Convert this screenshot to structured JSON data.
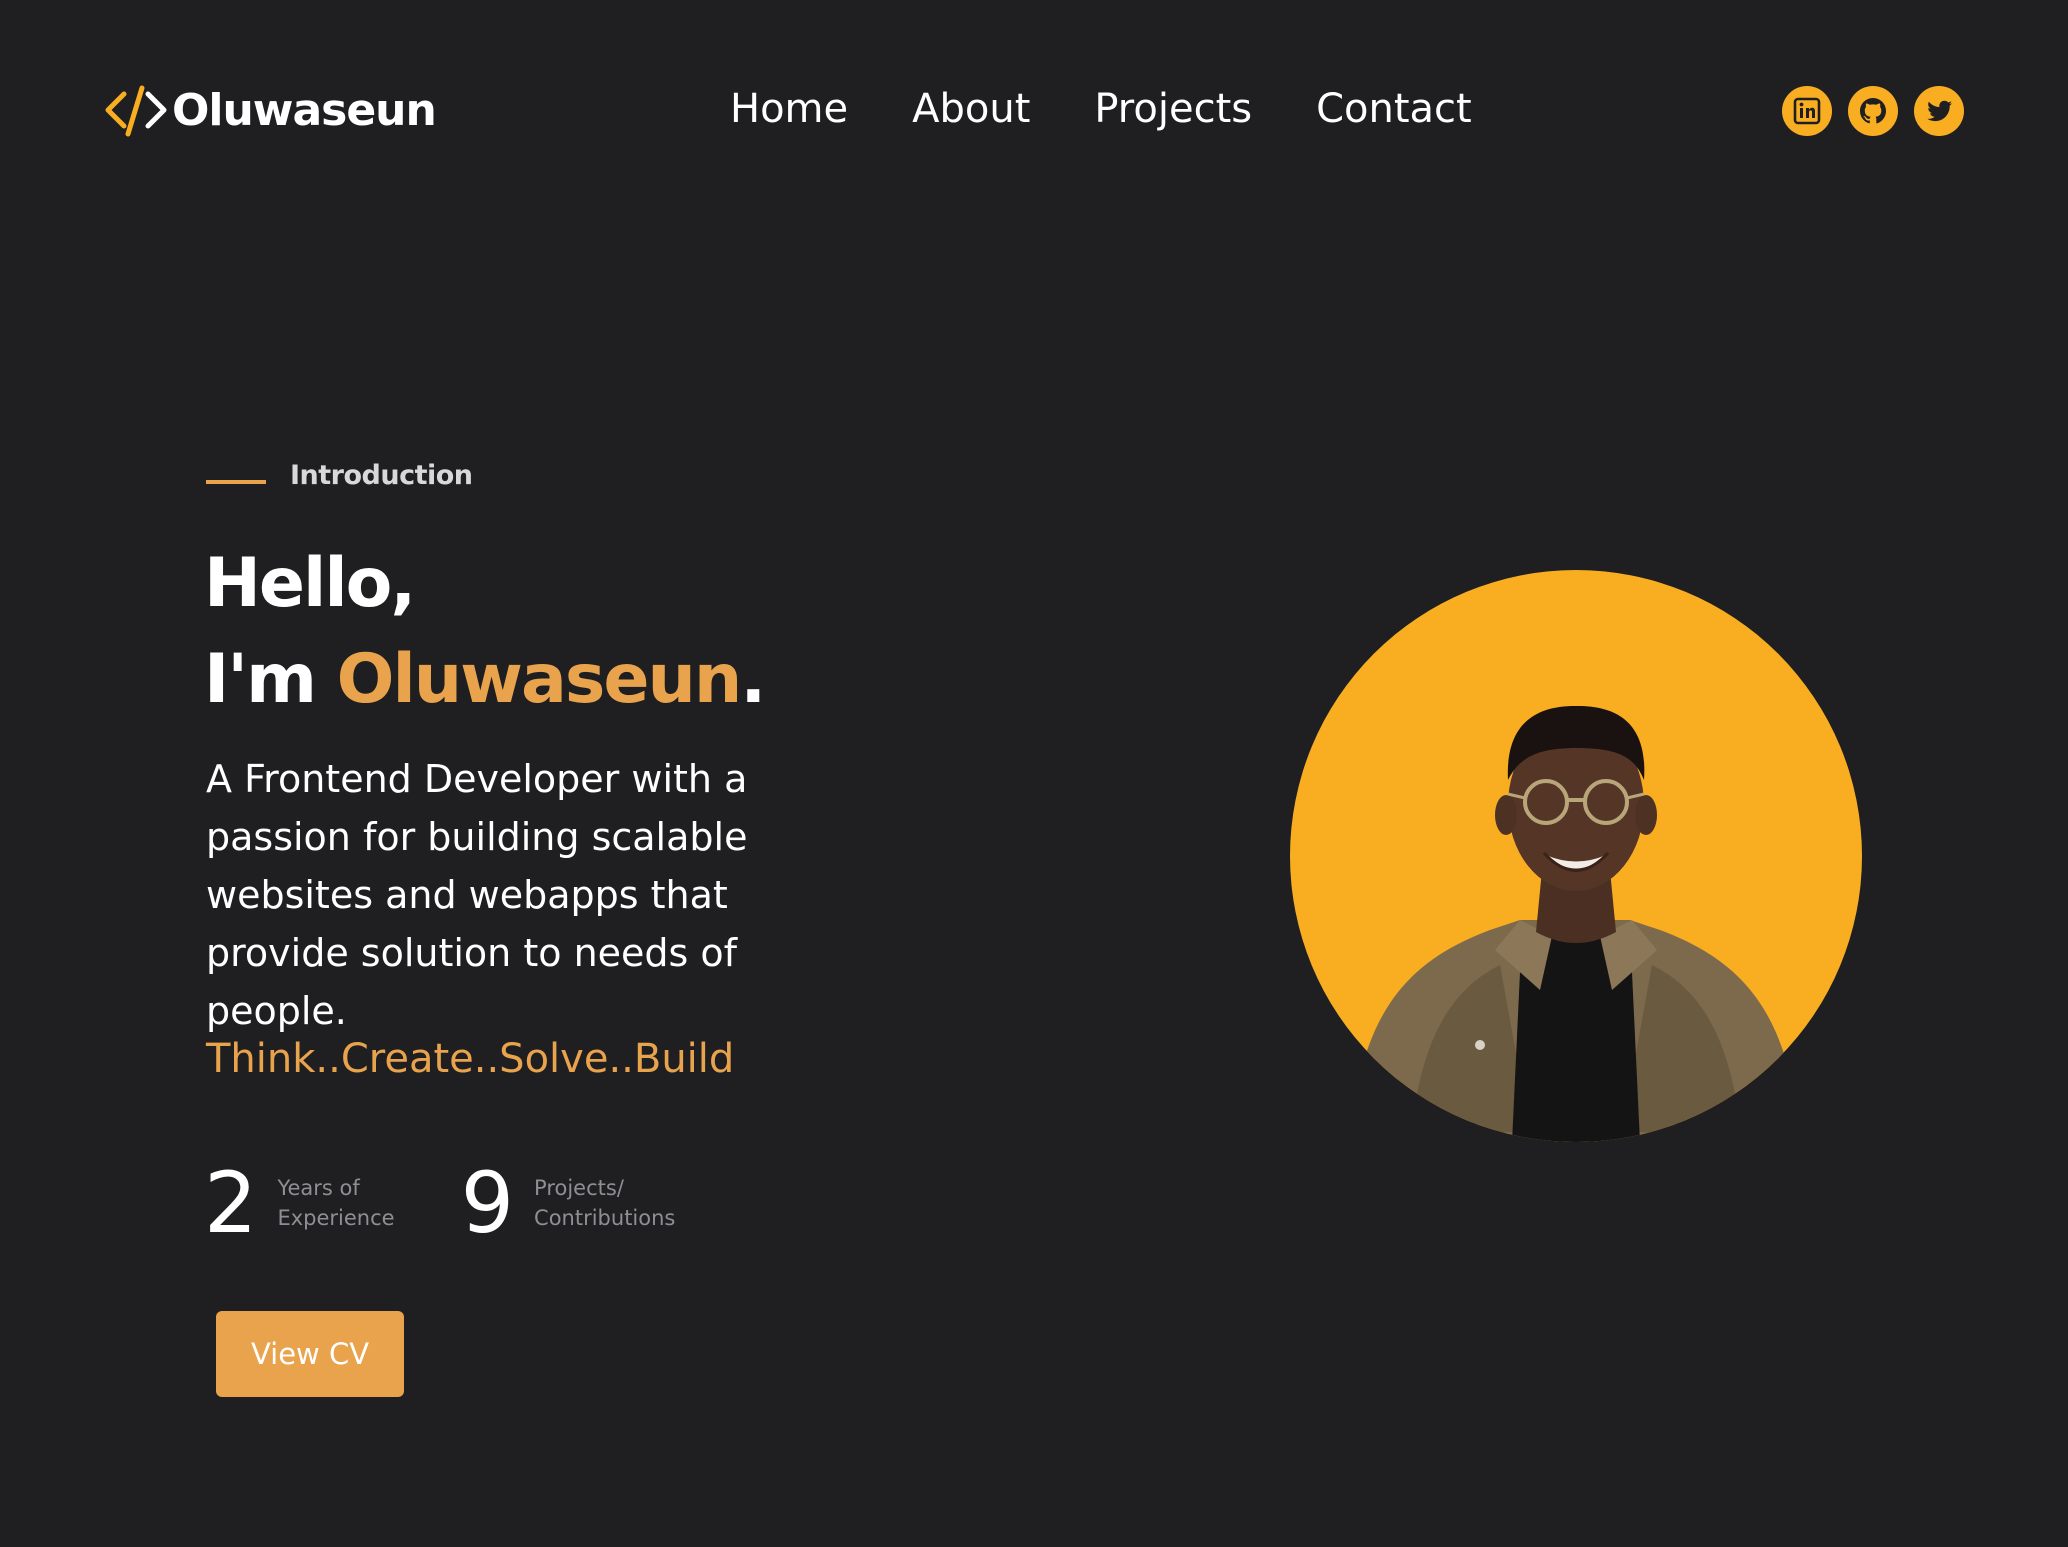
{
  "header": {
    "logo_text": "Oluwaseun",
    "nav": [
      {
        "label": "Home"
      },
      {
        "label": "About"
      },
      {
        "label": "Projects"
      },
      {
        "label": "Contact"
      }
    ],
    "socials": [
      {
        "icon": "linkedin-icon"
      },
      {
        "icon": "github-icon"
      },
      {
        "icon": "twitter-icon"
      }
    ]
  },
  "hero": {
    "intro_label": "Introduction",
    "greeting": "Hello,",
    "im_prefix": "I'm ",
    "name": "Oluwaseun",
    "name_suffix": ".",
    "description": "A Frontend Developer with a passion for building scalable websites and webapps that provide solution to needs of people.",
    "tagline": "Think..Create..Solve..Build",
    "stats": [
      {
        "number": "2",
        "label_line1": "Years of",
        "label_line2": "Experience"
      },
      {
        "number": "9",
        "label_line1": "Projects/",
        "label_line2": "Contributions"
      }
    ],
    "cv_button": "View CV"
  },
  "colors": {
    "background": "#1f1f21",
    "accent": "#e8a34c",
    "icon_accent": "#f9ae22"
  }
}
